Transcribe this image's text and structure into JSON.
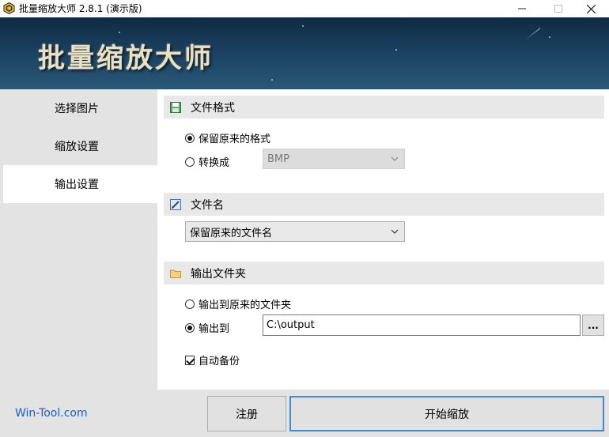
{
  "window": {
    "title": "批量缩放大师 2.8.1 (演示版)"
  },
  "banner": {
    "title": "批量缩放大师"
  },
  "sidebar": {
    "items": [
      {
        "label": "选择图片"
      },
      {
        "label": "缩放设置"
      },
      {
        "label": "输出设置"
      }
    ]
  },
  "file_format": {
    "header": "文件格式",
    "keep_label": "保留原来的格式",
    "convert_label": "转换成",
    "convert_value": "BMP"
  },
  "file_name": {
    "header": "文件名",
    "value": "保留原来的文件名"
  },
  "output_folder": {
    "header": "输出文件夹",
    "original_label": "输出到原来的文件夹",
    "output_to_label": "输出到",
    "path": "C:\\output",
    "browse_label": "...",
    "backup_label": "自动备份"
  },
  "footer": {
    "link": "Win-Tool.com",
    "register_label": "注册",
    "start_label": "开始缩放"
  },
  "colors": {
    "accent": "#3c8bd6",
    "link": "#1a5fc4",
    "banner_bg": "#1c4464"
  }
}
